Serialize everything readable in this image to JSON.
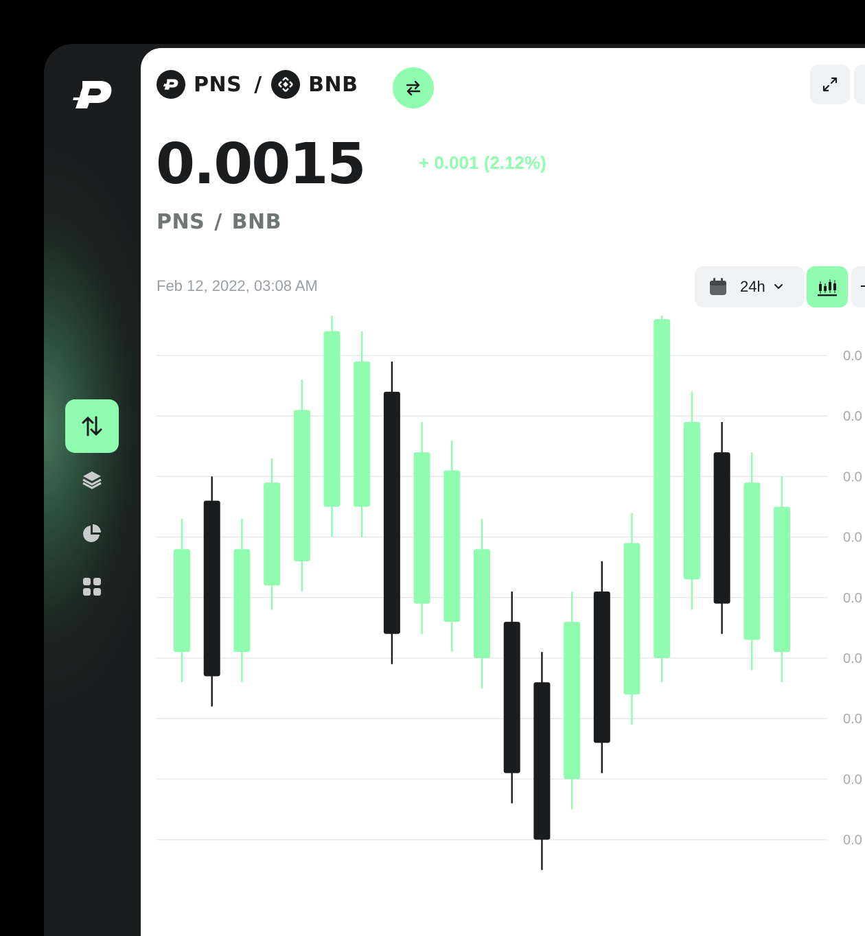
{
  "colors": {
    "accent": "#8ffcb0",
    "dark": "#1a1c1d",
    "up": "#8ffcb0",
    "down": "#1a1c1d"
  },
  "sidebar": {
    "logo_icon": "pinksale-logo-icon",
    "items": [
      {
        "icon": "swap-vertical-icon",
        "active": true
      },
      {
        "icon": "layers-icon",
        "active": false
      },
      {
        "icon": "pie-chart-icon",
        "active": false
      },
      {
        "icon": "grid-icon",
        "active": false
      }
    ]
  },
  "header": {
    "base_token": "PNS",
    "quote_token": "BNB",
    "separator": "/",
    "swap_icon": "swap-arrows-icon",
    "expand_icon": "expand-icon"
  },
  "price": {
    "value": "0.0015",
    "change": "+ 0.001 (2.12%)",
    "pair_label_base": "PNS",
    "pair_label_sep": "/",
    "pair_label_quote": "BNB"
  },
  "chart_header": {
    "timestamp": "Feb 12, 2022, 03:08 AM",
    "range": "24h",
    "range_icon": "calendar-icon",
    "chart_type_icon": "candlestick-icon"
  },
  "chart_data": {
    "type": "candlestick",
    "y_tick_labels": [
      "0.0",
      "0.0",
      "0.0",
      "0.0",
      "0.0",
      "0.0",
      "0.0",
      "0.0",
      "0.0"
    ],
    "ylim": [
      0,
      9
    ],
    "grid": true,
    "candles": [
      {
        "open": 3.1,
        "close": 4.8,
        "high": 5.3,
        "low": 2.6,
        "dir": "up"
      },
      {
        "open": 5.6,
        "close": 2.7,
        "high": 6.0,
        "low": 2.2,
        "dir": "down"
      },
      {
        "open": 3.1,
        "close": 4.8,
        "high": 5.3,
        "low": 2.6,
        "dir": "up"
      },
      {
        "open": 4.2,
        "close": 5.9,
        "high": 6.3,
        "low": 3.8,
        "dir": "up"
      },
      {
        "open": 4.6,
        "close": 7.1,
        "high": 7.6,
        "low": 4.1,
        "dir": "up"
      },
      {
        "open": 5.5,
        "close": 8.4,
        "high": 8.9,
        "low": 5.0,
        "dir": "up"
      },
      {
        "open": 5.5,
        "close": 7.9,
        "high": 8.4,
        "low": 5.0,
        "dir": "up"
      },
      {
        "open": 7.4,
        "close": 3.4,
        "high": 7.9,
        "low": 2.9,
        "dir": "down"
      },
      {
        "open": 3.9,
        "close": 6.4,
        "high": 6.9,
        "low": 3.4,
        "dir": "up"
      },
      {
        "open": 3.6,
        "close": 6.1,
        "high": 6.6,
        "low": 3.1,
        "dir": "up"
      },
      {
        "open": 3.0,
        "close": 4.8,
        "high": 5.3,
        "low": 2.5,
        "dir": "up"
      },
      {
        "open": 3.6,
        "close": 1.1,
        "high": 4.1,
        "low": 0.6,
        "dir": "down"
      },
      {
        "open": 2.6,
        "close": 0.0,
        "high": 3.1,
        "low": -0.5,
        "dir": "down"
      },
      {
        "open": 1.0,
        "close": 3.6,
        "high": 4.1,
        "low": 0.5,
        "dir": "up"
      },
      {
        "open": 4.1,
        "close": 1.6,
        "high": 4.6,
        "low": 1.1,
        "dir": "down"
      },
      {
        "open": 2.4,
        "close": 4.9,
        "high": 5.4,
        "low": 1.9,
        "dir": "up"
      },
      {
        "open": 3.0,
        "close": 8.6,
        "high": 9.1,
        "low": 2.6,
        "dir": "up"
      },
      {
        "open": 4.3,
        "close": 6.9,
        "high": 7.4,
        "low": 3.8,
        "dir": "up"
      },
      {
        "open": 6.4,
        "close": 3.9,
        "high": 6.9,
        "low": 3.4,
        "dir": "down"
      },
      {
        "open": 3.3,
        "close": 5.9,
        "high": 6.4,
        "low": 2.8,
        "dir": "up"
      },
      {
        "open": 3.1,
        "close": 5.5,
        "high": 6.0,
        "low": 2.6,
        "dir": "up"
      }
    ]
  }
}
